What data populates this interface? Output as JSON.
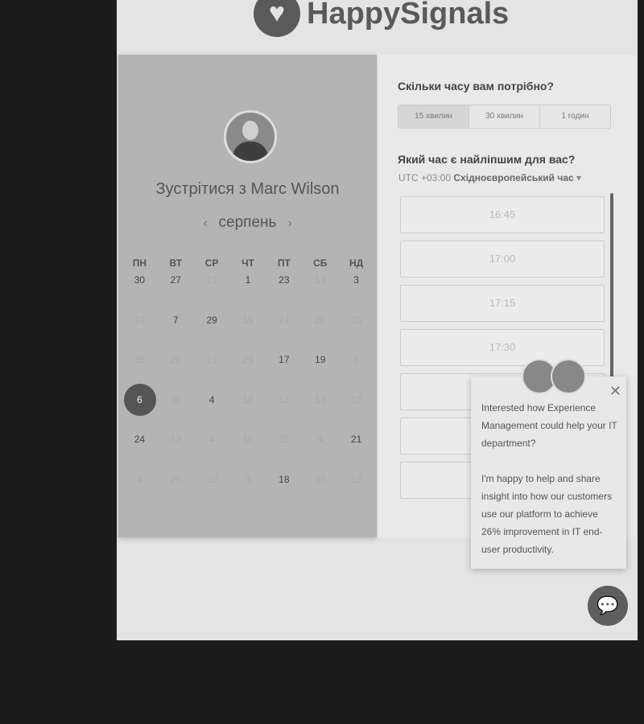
{
  "brand": "HappySignals",
  "left": {
    "meet_prefix": "Зустрітися з",
    "host": "Marc Wilson",
    "month": "серпень",
    "prev": "‹",
    "next": "›",
    "weekdays": [
      "ПН",
      "ВТ",
      "СР",
      "ЧТ",
      "ПТ",
      "СБ",
      "НД"
    ],
    "days": [
      {
        "d": "30",
        "s": "on"
      },
      {
        "d": "27",
        "s": "on"
      },
      {
        "d": "19",
        "s": "off"
      },
      {
        "d": "1",
        "s": "on"
      },
      {
        "d": "23",
        "s": "on"
      },
      {
        "d": "13",
        "s": "off"
      },
      {
        "d": "3",
        "s": "on"
      },
      {
        "d": "24",
        "s": "off"
      },
      {
        "d": "7",
        "s": "on"
      },
      {
        "d": "29",
        "s": "on"
      },
      {
        "d": "19",
        "s": "off"
      },
      {
        "d": "24",
        "s": "off"
      },
      {
        "d": "26",
        "s": "off"
      },
      {
        "d": "26",
        "s": "off"
      },
      {
        "d": "25",
        "s": "off"
      },
      {
        "d": "28",
        "s": "off"
      },
      {
        "d": "19",
        "s": "off"
      },
      {
        "d": "29",
        "s": "off"
      },
      {
        "d": "17",
        "s": "on"
      },
      {
        "d": "19",
        "s": "on"
      },
      {
        "d": "3",
        "s": "off"
      },
      {
        "d": "6",
        "s": "sel"
      },
      {
        "d": "30",
        "s": "off"
      },
      {
        "d": "4",
        "s": "on"
      },
      {
        "d": "18",
        "s": "off"
      },
      {
        "d": "13",
        "s": "off"
      },
      {
        "d": "13",
        "s": "off"
      },
      {
        "d": "12",
        "s": "off"
      },
      {
        "d": "24",
        "s": "on"
      },
      {
        "d": "13",
        "s": "off"
      },
      {
        "d": "4",
        "s": "off"
      },
      {
        "d": "16",
        "s": "off"
      },
      {
        "d": "25",
        "s": "off"
      },
      {
        "d": "4",
        "s": "off"
      },
      {
        "d": "21",
        "s": "on"
      },
      {
        "d": "4",
        "s": "off"
      },
      {
        "d": "25",
        "s": "off"
      },
      {
        "d": "10",
        "s": "off"
      },
      {
        "d": "3",
        "s": "off"
      },
      {
        "d": "18",
        "s": "on"
      },
      {
        "d": "30",
        "s": "off"
      },
      {
        "d": "12",
        "s": "off"
      }
    ]
  },
  "right": {
    "duration_q": "Скільки часу вам потрібно?",
    "durations": [
      "15 хвилин",
      "30 хвилин",
      "1 годин"
    ],
    "time_q": "Який час є найліпшим для вас?",
    "tz_offset": "UTC +03:00",
    "tz_name": "Східноєвропейський час",
    "tz_caret": "▾",
    "slots": [
      "16:45",
      "17:00",
      "17:15",
      "17:30",
      "",
      "",
      "",
      ""
    ]
  },
  "popup": {
    "text1": "Interested how Experience Management could help your IT department?",
    "text2": "I'm happy to help and share insight into how our customers use our platform to achieve 26% improvement in IT end-user productivity.",
    "close": "✕"
  }
}
